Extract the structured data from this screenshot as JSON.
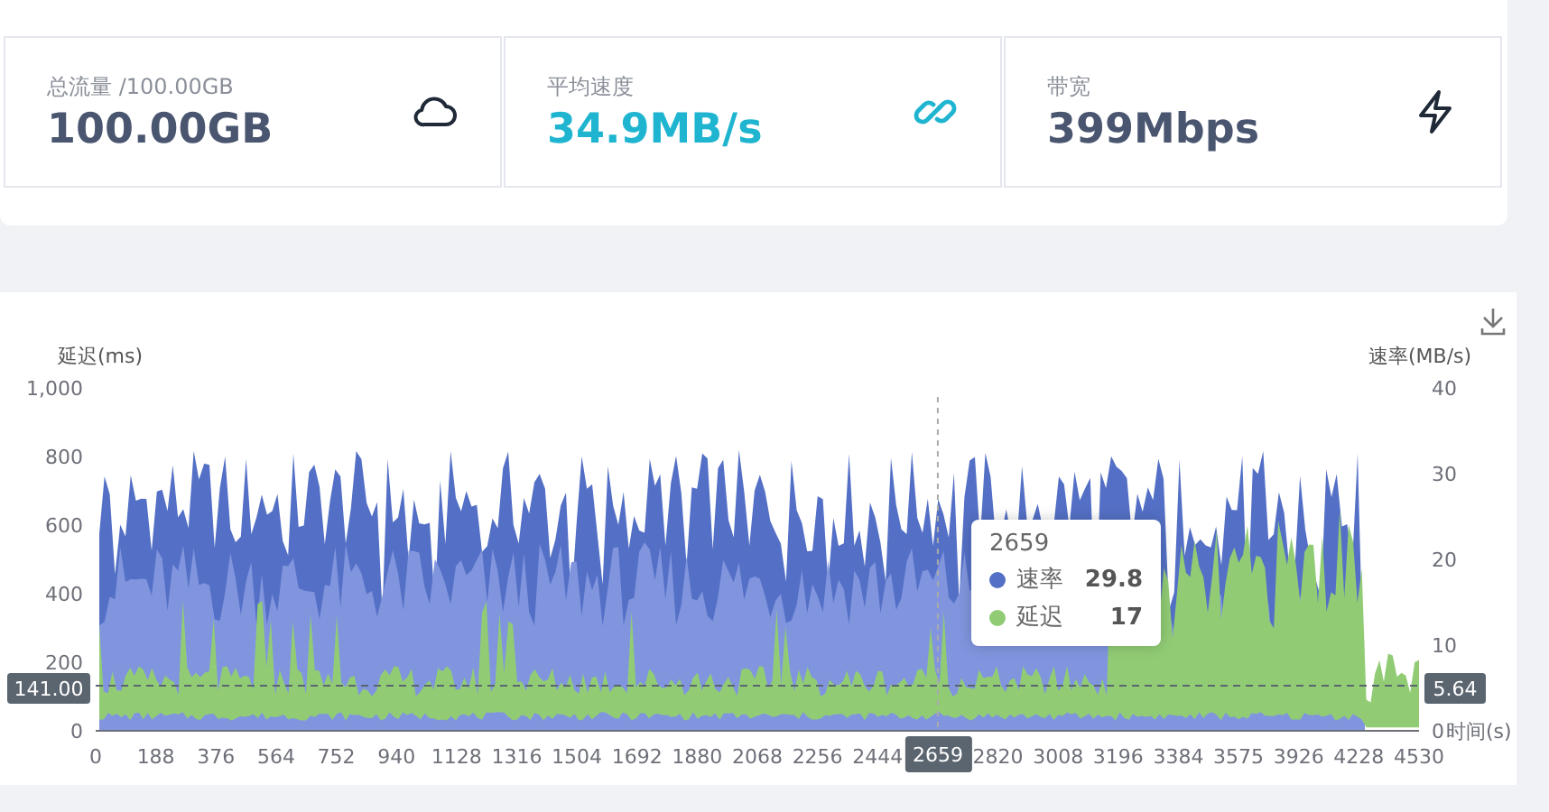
{
  "stats": [
    {
      "label": "总流量 /100.00GB",
      "value": "100.00GB",
      "kind": "cloud",
      "accent": false
    },
    {
      "label": "平均速度",
      "value": "34.9MB/s",
      "kind": "link",
      "accent": true
    },
    {
      "label": "带宽",
      "value": "399Mbps",
      "kind": "bolt",
      "accent": false
    }
  ],
  "chart": {
    "left_axis_title": "延迟(ms)",
    "right_axis_title": "速率(MB/s)",
    "x_axis_title": "时间(s)",
    "left_ticks": [
      "1,000",
      "800",
      "600",
      "400",
      "200",
      "0"
    ],
    "right_ticks": [
      "40",
      "30",
      "20",
      "10",
      "0"
    ],
    "x_ticks": [
      {
        "label": "0",
        "selected": false
      },
      {
        "label": "188",
        "selected": false
      },
      {
        "label": "376",
        "selected": false
      },
      {
        "label": "564",
        "selected": false
      },
      {
        "label": "752",
        "selected": false
      },
      {
        "label": "940",
        "selected": false
      },
      {
        "label": "1128",
        "selected": false
      },
      {
        "label": "1316",
        "selected": false
      },
      {
        "label": "1504",
        "selected": false
      },
      {
        "label": "1692",
        "selected": false
      },
      {
        "label": "1880",
        "selected": false
      },
      {
        "label": "2068",
        "selected": false
      },
      {
        "label": "2256",
        "selected": false
      },
      {
        "label": "2444",
        "selected": false
      },
      {
        "label": "2659",
        "selected": true
      },
      {
        "label": "2820",
        "selected": false
      },
      {
        "label": "3008",
        "selected": false
      },
      {
        "label": "3196",
        "selected": false
      },
      {
        "label": "3384",
        "selected": false
      },
      {
        "label": "3575",
        "selected": false
      },
      {
        "label": "3926",
        "selected": false
      },
      {
        "label": "4228",
        "selected": false
      },
      {
        "label": "4530",
        "selected": false
      }
    ],
    "left_marker": "141.00",
    "right_marker": "5.64",
    "tooltip": {
      "title": "2659",
      "rows": [
        {
          "name": "速率",
          "value": "29.8",
          "color": "#5470c6"
        },
        {
          "name": "延迟",
          "value": "17",
          "color": "#91cc75"
        }
      ]
    }
  }
}
